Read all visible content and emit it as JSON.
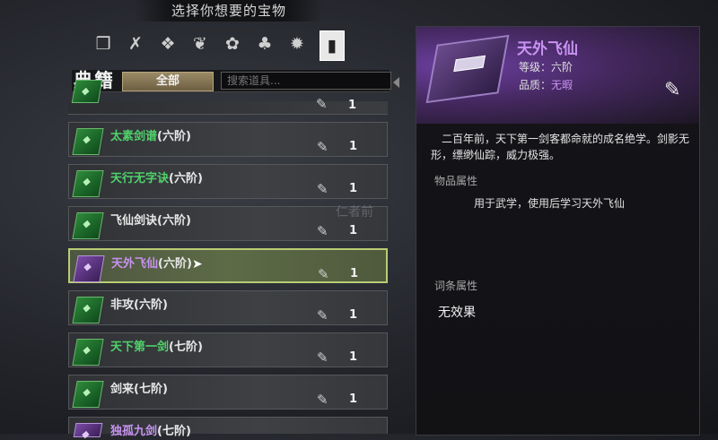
{
  "header": {
    "title": "选择你想要的宝物"
  },
  "categories": [
    {
      "icon": "chest-icon",
      "glyph": "❒"
    },
    {
      "icon": "weapon-icon",
      "glyph": "✗"
    },
    {
      "icon": "armor-icon",
      "glyph": "❖"
    },
    {
      "icon": "accessory-icon",
      "glyph": "❦"
    },
    {
      "icon": "pill-icon",
      "glyph": "✿"
    },
    {
      "icon": "herb-icon",
      "glyph": "♣"
    },
    {
      "icon": "bomb-icon",
      "glyph": "✹"
    },
    {
      "icon": "book-icon",
      "glyph": "▮"
    }
  ],
  "filter": {
    "label": "典籍",
    "tab_all": "全部",
    "search_placeholder": "搜索道具..."
  },
  "items": [
    {
      "name": "太素剑谱",
      "level": "(六阶)",
      "qty": "1",
      "color": "green"
    },
    {
      "name": "天行无字诀",
      "level": "(六阶)",
      "qty": "1",
      "color": "green"
    },
    {
      "name": "飞仙剑诀",
      "level": "(六阶)",
      "qty": "1",
      "color": "white"
    },
    {
      "name": "天外飞仙",
      "level": "(六阶)",
      "qty": "1",
      "color": "purple"
    },
    {
      "name": "非攻",
      "level": "(六阶)",
      "qty": "1",
      "color": "white"
    },
    {
      "name": "天下第一剑",
      "level": "(七阶)",
      "qty": "1",
      "color": "green"
    },
    {
      "name": "剑来",
      "level": "(七阶)",
      "qty": "1",
      "color": "white"
    }
  ],
  "partial_top_qty": "1",
  "partial_bottom": {
    "name": "独孤九剑",
    "level": "(七阶)"
  },
  "detail": {
    "name": "天外飞仙",
    "grade": "等级：六阶",
    "quality_label": "品质：",
    "quality_value": "无暇",
    "description": "二百年前，天下第一剑客都命就的成名绝学。剑影无形，缥缈仙踪，威力极强。",
    "section_attrs": "物品属性",
    "use_text": "用于武学，使用后学习天外飞仙",
    "section_traits": "词条属性",
    "effect": "无效果"
  },
  "watermark": "仁者前"
}
